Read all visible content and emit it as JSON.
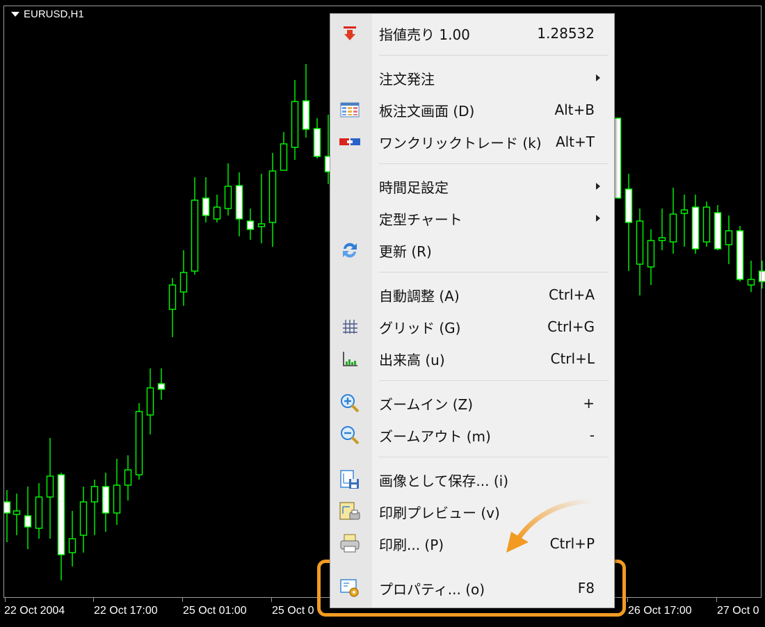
{
  "chart": {
    "symbol": "EURUSD,H1",
    "up_color": "#00ff00",
    "bg_color": "#000000",
    "x_labels": [
      "22 Oct 2004",
      "22 Oct 17:00",
      "25 Oct 01:00",
      "25 Oct 0",
      "26 Oct 17:00",
      "27 Oct 0"
    ]
  },
  "menu": {
    "items": [
      {
        "label": "指値売り 1.00",
        "shortcut": "1.28532",
        "icon": "sell-arrow-icon"
      },
      {
        "label": "注文発注",
        "shortcut": "",
        "submenu": true
      },
      {
        "label": "板注文画面 (D)",
        "shortcut": "Alt+B",
        "icon": "order-book-icon"
      },
      {
        "label": "ワンクリックトレード (k)",
        "shortcut": "Alt+T",
        "icon": "one-click-trade-icon"
      },
      {
        "label": "時間足設定",
        "shortcut": "",
        "submenu": true
      },
      {
        "label": "定型チャート",
        "shortcut": "",
        "submenu": true
      },
      {
        "label": "更新 (R)",
        "shortcut": "",
        "icon": "refresh-icon"
      },
      {
        "label": "自動調整 (A)",
        "shortcut": "Ctrl+A"
      },
      {
        "label": "グリッド (G)",
        "shortcut": "Ctrl+G",
        "icon": "grid-icon"
      },
      {
        "label": "出来高 (u)",
        "shortcut": "Ctrl+L",
        "icon": "volume-icon"
      },
      {
        "label": "ズームイン (Z)",
        "shortcut": "+",
        "icon": "zoom-in-icon"
      },
      {
        "label": "ズームアウト (m)",
        "shortcut": "-",
        "icon": "zoom-out-icon"
      },
      {
        "label": "画像として保存... (i)",
        "shortcut": "",
        "icon": "save-image-icon"
      },
      {
        "label": "印刷プレビュー (v)",
        "shortcut": "",
        "icon": "print-preview-icon"
      },
      {
        "label": "印刷... (P)",
        "shortcut": "Ctrl+P",
        "icon": "print-icon"
      },
      {
        "label": "プロパティ... (o)",
        "shortcut": "F8",
        "icon": "properties-icon"
      }
    ]
  },
  "highlight_color": "#f39a23"
}
